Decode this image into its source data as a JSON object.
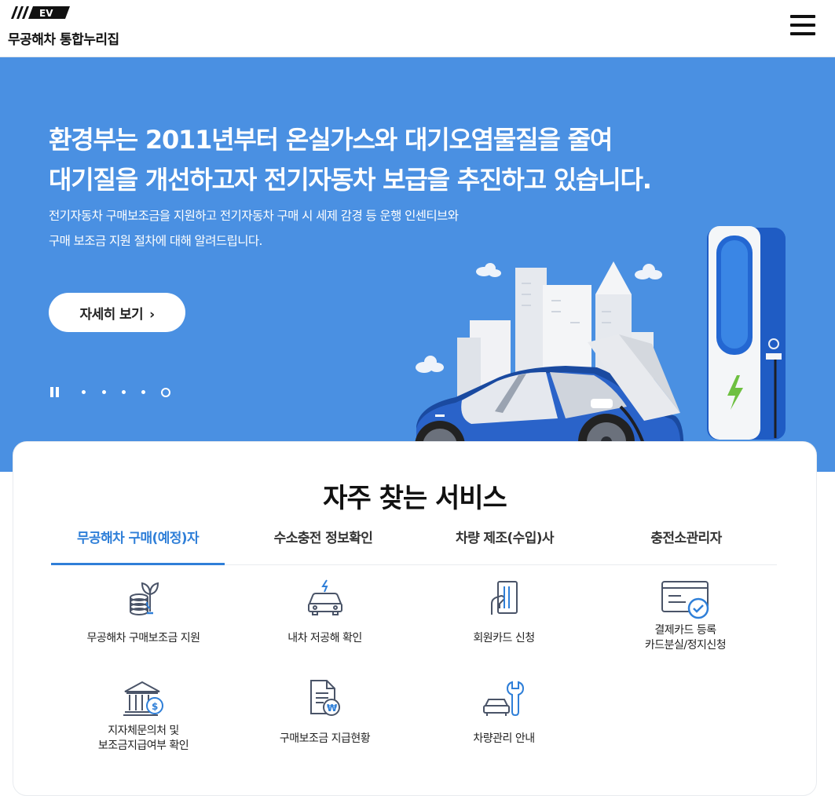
{
  "header": {
    "logo_badge": "EV",
    "logo_text": "무공해차 통합누리집",
    "menu_icon": "hamburger-menu-icon"
  },
  "hero": {
    "title_line1": "환경부는 2011년부터 온실가스와 대기오염물질을 줄여",
    "title_line2": "대기질을 개선하고자 전기자동차 보급을 추진하고 있습니다.",
    "sub_line1": "전기자동차 구매보조금을 지원하고 전기자동차 구매 시 세제 감경 등 운행 인센티브와",
    "sub_line2": "구매 보조금 지원 절차에 대해 알려드립니다.",
    "more_label": "자세히 보기",
    "slides_total": 5,
    "slide_active": 5,
    "colors": {
      "background": "#4a90e2"
    }
  },
  "services": {
    "title": "자주 찾는 서비스",
    "tabs": [
      {
        "label": "무공해차 구매(예정)자",
        "active": true
      },
      {
        "label": "수소충전 정보확인",
        "active": false
      },
      {
        "label": "차량 제조(수입)사",
        "active": false
      },
      {
        "label": "충전소관리자",
        "active": false
      }
    ],
    "items": [
      {
        "line1": "무공해차 구매보조금 지원",
        "line2": "",
        "icon": "subsidy-coins-plant-icon"
      },
      {
        "line1": "내차 저공해 확인",
        "line2": "",
        "icon": "low-emission-car-icon"
      },
      {
        "line1": "회원카드 신청",
        "line2": "",
        "icon": "hand-card-icon"
      },
      {
        "line1": "결제카드 등록",
        "line2": "카드분실/정지신청",
        "icon": "card-check-icon"
      },
      {
        "line1": "지자체문의처 및",
        "line2": "보조금지급여부 확인",
        "icon": "government-building-icon"
      },
      {
        "line1": "구매보조금 지급현황",
        "line2": "",
        "icon": "document-won-icon"
      },
      {
        "line1": "차량관리 안내",
        "line2": "",
        "icon": "car-wrench-icon"
      }
    ],
    "colors": {
      "accent": "#2f7fd8",
      "icon_stroke": "#4a5468"
    }
  }
}
